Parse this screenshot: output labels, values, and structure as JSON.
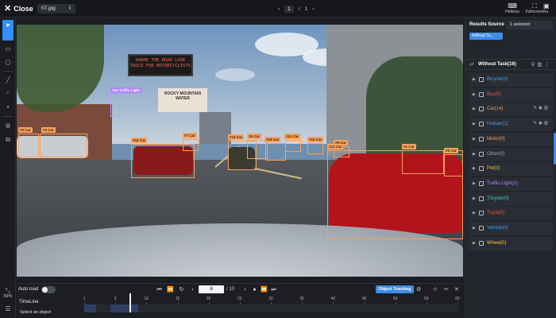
{
  "topbar": {
    "close_label": "Close",
    "file_name": "07.jpg",
    "info_icon": "i",
    "page_current": "1",
    "page_sep": "/",
    "page_total": "1",
    "hotkeys_label": "Hotkeys",
    "fullscreen_label": "Fullscreen",
    "save_label": "Sa"
  },
  "left_tools": {
    "zoom": "69%"
  },
  "canvas": {
    "sign_text": "SHARE THE ROAD LOOK TWICE FOR MOTORCYCLISTS",
    "billboard_text": "ROCKY MOUNTAIN WATER",
    "annotations": [
      {
        "id": "b1",
        "label": "#3 Car"
      },
      {
        "id": "b2",
        "label": "#2 Car"
      },
      {
        "id": "b3",
        "label": "#10 Traffic-Light"
      },
      {
        "id": "b4",
        "label": "#16 Car"
      },
      {
        "id": "b5",
        "label": "#7 Car"
      },
      {
        "id": "b6",
        "label": "#14 Car"
      },
      {
        "id": "b7",
        "label": "#6 Car"
      },
      {
        "id": "b8",
        "label": "#18 Car"
      },
      {
        "id": "b9",
        "label": "#11 Car"
      },
      {
        "id": "b10",
        "label": "#15 Car"
      },
      {
        "id": "b11",
        "label": "#8 Car"
      },
      {
        "id": "b12",
        "label": "#13 Car"
      },
      {
        "id": "b13",
        "label": "#1 Car"
      },
      {
        "id": "b14",
        "label": "#5 Car"
      }
    ]
  },
  "results_panel": {
    "title": "Results Source",
    "selected": "1 selected",
    "source_tag": "Without Ta...",
    "group_title": "Without Task(16)",
    "classes": [
      {
        "name": "Bicycle(0)",
        "color": "#3da4ff"
      },
      {
        "name": "Bus(0)",
        "color": "#e05a4e"
      },
      {
        "name": "Car(14)",
        "color": "#f5a25d"
      },
      {
        "name": "Human(1)",
        "color": "#3da4ff"
      },
      {
        "name": "Motor(0)",
        "color": "#f5a25d"
      },
      {
        "name": "Other(0)",
        "color": "#9aa0a8"
      },
      {
        "name": "Pet(0)",
        "color": "#f5c542"
      },
      {
        "name": "Traffic-Light(1)",
        "color": "#b183ff"
      },
      {
        "name": "Tricycle(0)",
        "color": "#3dd6c6"
      },
      {
        "name": "Truck(0)",
        "color": "#e05a4e"
      },
      {
        "name": "Vehicle(0)",
        "color": "#3da4ff"
      },
      {
        "name": "Wheel(0)",
        "color": "#f5c542"
      }
    ]
  },
  "bottom": {
    "autoload_label": "Auto load",
    "frame_value": "8",
    "frame_total": "/ 10",
    "tracking_label": "Object Tracking",
    "timeline_label": "TimeLine",
    "select_label": "Select an object",
    "ticks": [
      "1",
      "5",
      "10",
      "15",
      "20",
      "25",
      "30",
      "35",
      "40",
      "45",
      "50",
      "55",
      "60"
    ]
  }
}
